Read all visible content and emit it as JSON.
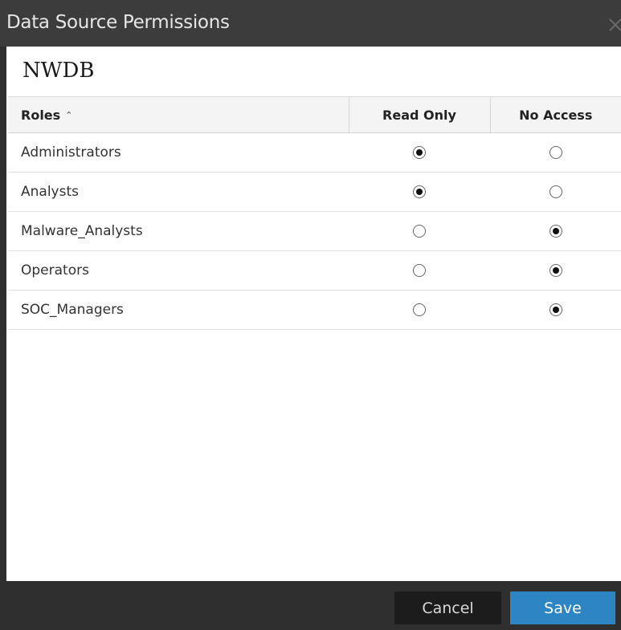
{
  "dialog": {
    "title": "Data Source Permissions",
    "close_icon": "close-icon"
  },
  "section": {
    "title": "NWDB"
  },
  "table": {
    "columns": {
      "role": "Roles",
      "role_sort": "ascending",
      "read_only": "Read Only",
      "no_access": "No Access"
    },
    "rows": [
      {
        "role": "Administrators",
        "permission": "Read Only"
      },
      {
        "role": "Analysts",
        "permission": "Read Only"
      },
      {
        "role": "Malware_Analysts",
        "permission": "No Access"
      },
      {
        "role": "Operators",
        "permission": "No Access"
      },
      {
        "role": "SOC_Managers",
        "permission": "No Access"
      }
    ]
  },
  "footer": {
    "cancel_label": "Cancel",
    "save_label": "Save"
  },
  "colors": {
    "title_bar": "#3c3c3c",
    "footer": "#2f2f2f",
    "save_button": "#2e85c4",
    "cancel_button": "#1c1c1c"
  }
}
